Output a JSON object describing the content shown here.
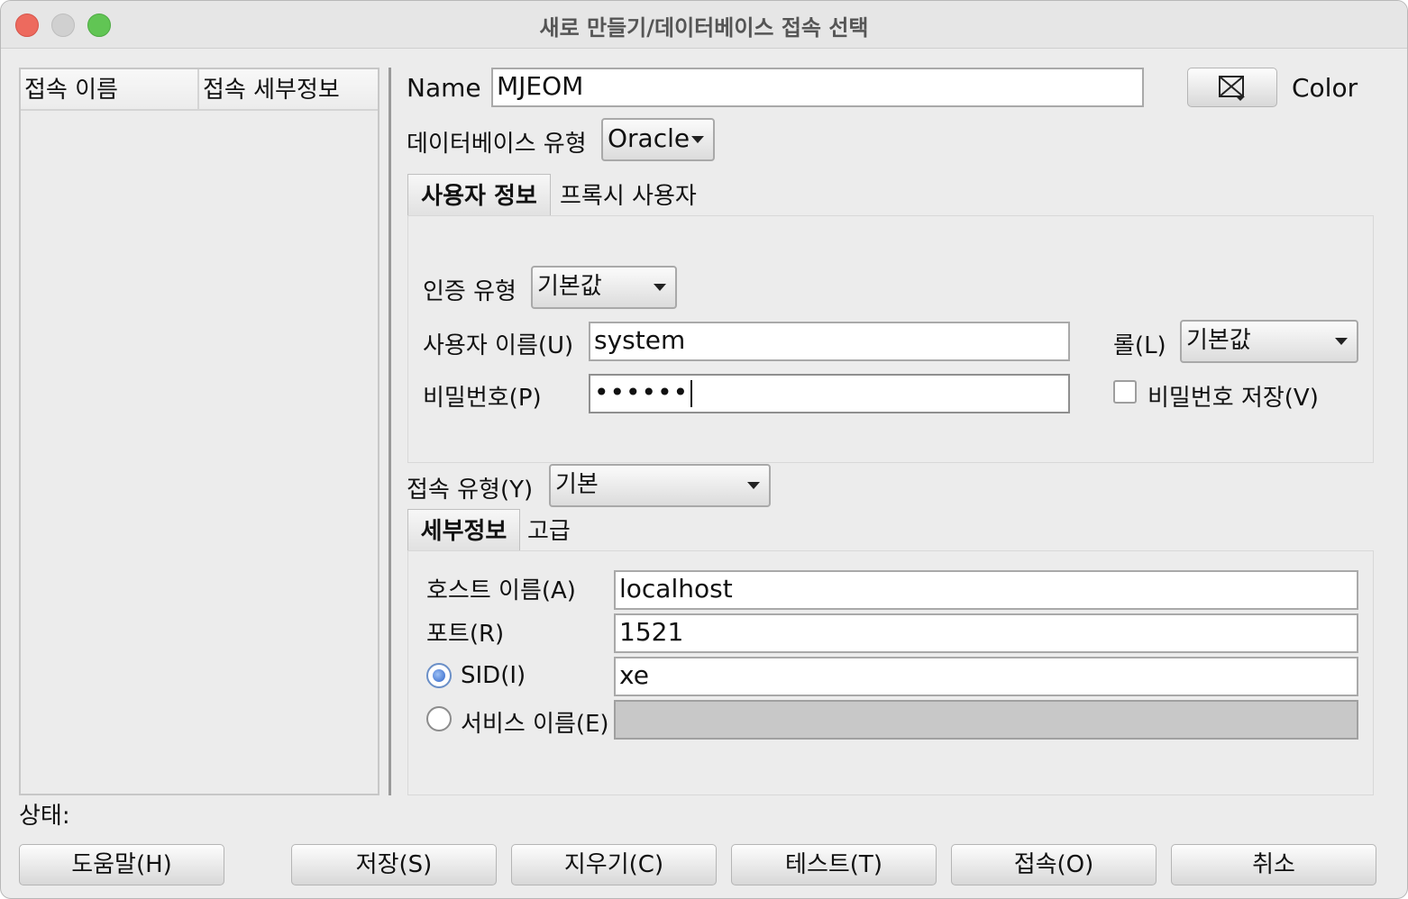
{
  "window": {
    "title": "새로 만들기/데이터베이스 접속 선택"
  },
  "connections_list": {
    "columns": [
      "접속 이름",
      "접속 세부정보"
    ]
  },
  "name_row": {
    "label": "Name",
    "value": "MJEOM",
    "color_label": "Color"
  },
  "db_type": {
    "label": "데이터베이스 유형",
    "selected": "Oracle"
  },
  "user_tabs": [
    "사용자 정보",
    "프록시 사용자"
  ],
  "auth": {
    "label": "인증 유형",
    "selected": "기본값"
  },
  "username": {
    "label": "사용자 이름(U)",
    "value": "system"
  },
  "role": {
    "label": "롤(L)",
    "selected": "기본값"
  },
  "password": {
    "label": "비밀번호(P)",
    "masked_value": "••••••",
    "save_label": "비밀번호 저장(V)",
    "save_checked": false
  },
  "conn_type": {
    "label": "접속 유형(Y)",
    "selected": "기본"
  },
  "detail_tabs": [
    "세부정보",
    "고급"
  ],
  "host": {
    "label": "호스트 이름(A)",
    "value": "localhost"
  },
  "port": {
    "label": "포트(R)",
    "value": "1521"
  },
  "sid": {
    "label": "SID(I)",
    "value": "xe",
    "selected": true
  },
  "service": {
    "label": "서비스 이름(E)",
    "value": "",
    "selected": false
  },
  "status": {
    "label": "상태:"
  },
  "buttons": {
    "help": "도움말(H)",
    "save": "저장(S)",
    "clear": "지우기(C)",
    "test": "테스트(T)",
    "connect": "접속(O)",
    "cancel": "취소"
  }
}
